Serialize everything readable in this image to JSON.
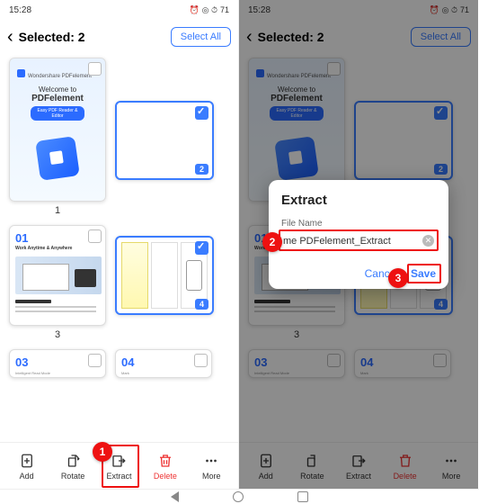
{
  "status": {
    "time": "15:28",
    "battery": "71"
  },
  "header": {
    "title": "Selected: 2",
    "select_all": "Select All"
  },
  "pages": {
    "p1": {
      "caption": "1",
      "welcome": "Welcome to",
      "product": "PDFelement",
      "tag": "Easy PDF Reader & Editor",
      "brand": "Wondershare PDFelement"
    },
    "p2": {
      "caption": "",
      "badge": "2"
    },
    "p3": {
      "caption": "3",
      "num": "01",
      "sub": "Work Anytime & Anywhere",
      "subd": "",
      "heading": "Reading"
    },
    "p4": {
      "caption": "",
      "badge": "4"
    },
    "p5": {
      "num": "03",
      "sub": "Intelligent Read Mode"
    },
    "p6": {
      "num": "04",
      "sub": "Mark"
    }
  },
  "toolbar": {
    "add": "Add",
    "rotate": "Rotate",
    "extract": "Extract",
    "delete": "Delete",
    "more": "More"
  },
  "dialog": {
    "title": "Extract",
    "label": "File Name",
    "value": "me PDFelement_Extract",
    "cancel": "Cancel",
    "save": "Save"
  },
  "callouts": {
    "c1": "1",
    "c2": "2",
    "c3": "3"
  }
}
